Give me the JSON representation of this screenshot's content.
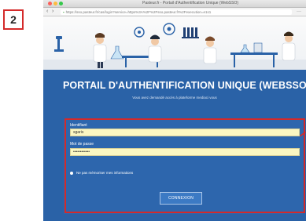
{
  "step": {
    "number": "2"
  },
  "window": {
    "title": "Pasteur.fr - Portail d'Authentification Unique (WebSSO)",
    "url": "https://sso.pasteur.fr/cas/login?service=https%3A%2F%2Fsso.pasteur.fr%2Fexecution=e1s1"
  },
  "portal": {
    "title": "PORTAIL D'AUTHENTIFICATION UNIQUE (WEBSSO)",
    "subtitle": "Vous avez demandé accès à plateforme mediaci vous"
  },
  "form": {
    "username_label": "Identifiant",
    "username_value": "sgaris",
    "password_label": "Mot de passe",
    "password_value": "••••••••••••",
    "remember_label": "Ne pas mémoriser mes informations",
    "submit_label": "CONNEXION"
  },
  "colors": {
    "portal_blue": "#2a62a7",
    "highlight_red": "#d42a2a",
    "input_yellow": "#fbf7c2"
  }
}
